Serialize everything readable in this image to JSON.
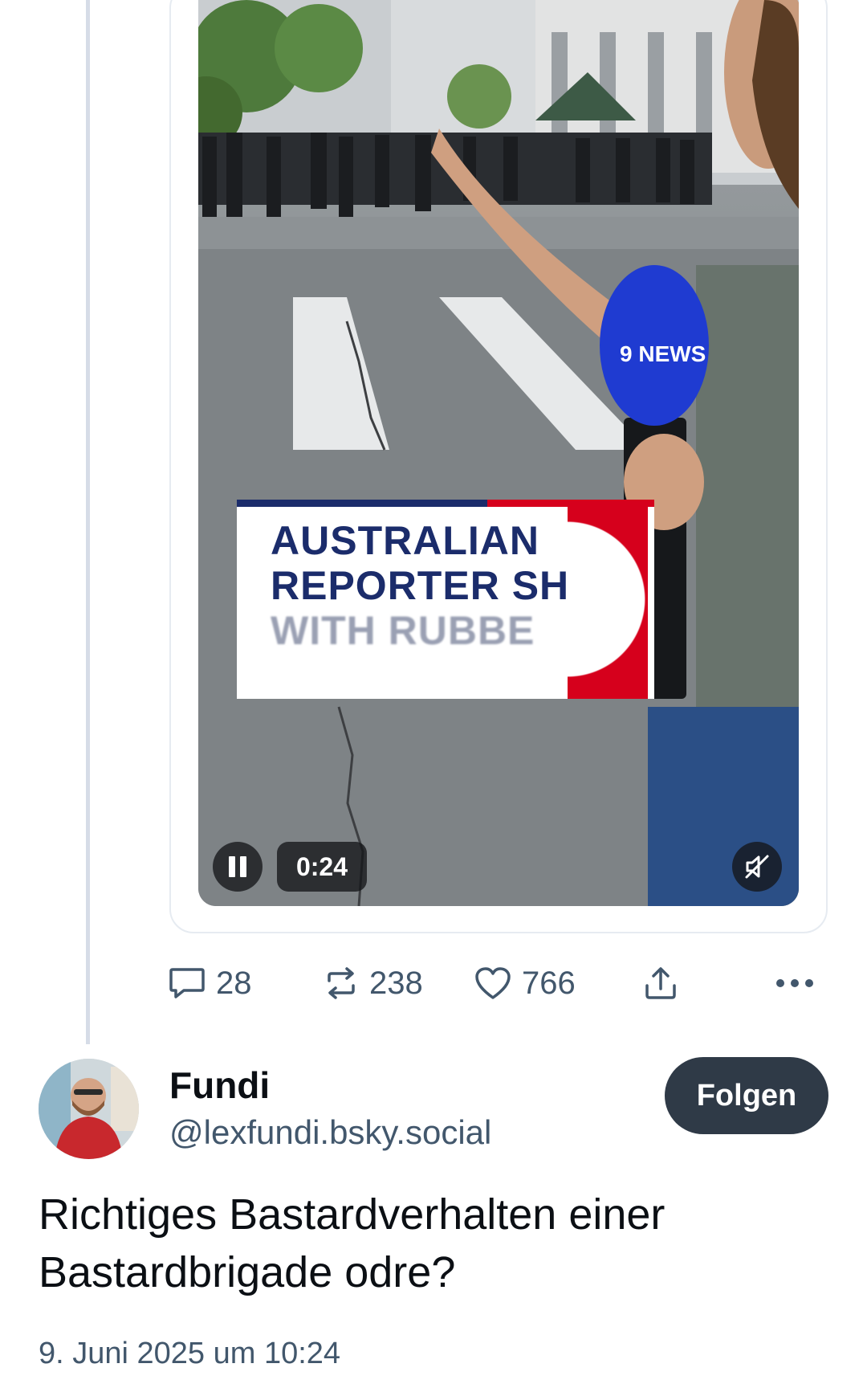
{
  "video": {
    "overlay_line1": "AUSTRALIAN",
    "overlay_line2": "REPORTER SH",
    "overlay_line3": "WITH RUBBE",
    "mic_brand": "9 NEWS",
    "timestamp": "0:24",
    "pause_icon": "pause-icon",
    "mute_icon": "speaker-muted-icon"
  },
  "actions": {
    "reply_count": "28",
    "repost_count": "238",
    "like_count": "766",
    "share_icon": "share-icon",
    "more_icon": "more-options-icon"
  },
  "author": {
    "name": "Fundi",
    "handle": "@lexfundi.bsky.social",
    "follow_label": "Folgen"
  },
  "post": {
    "text": "Richtiges Bastardverhalten einer Bastardbrigade odre?",
    "date": "9. Juni 2025 um 10:24"
  },
  "colors": {
    "muted_text": "#42576c",
    "follow_button": "#2f3a47",
    "thread_line": "#d6dce7",
    "news_navy": "#1b2c6b",
    "news_red": "#d6001c",
    "mic_blue": "#1f3bd1"
  }
}
